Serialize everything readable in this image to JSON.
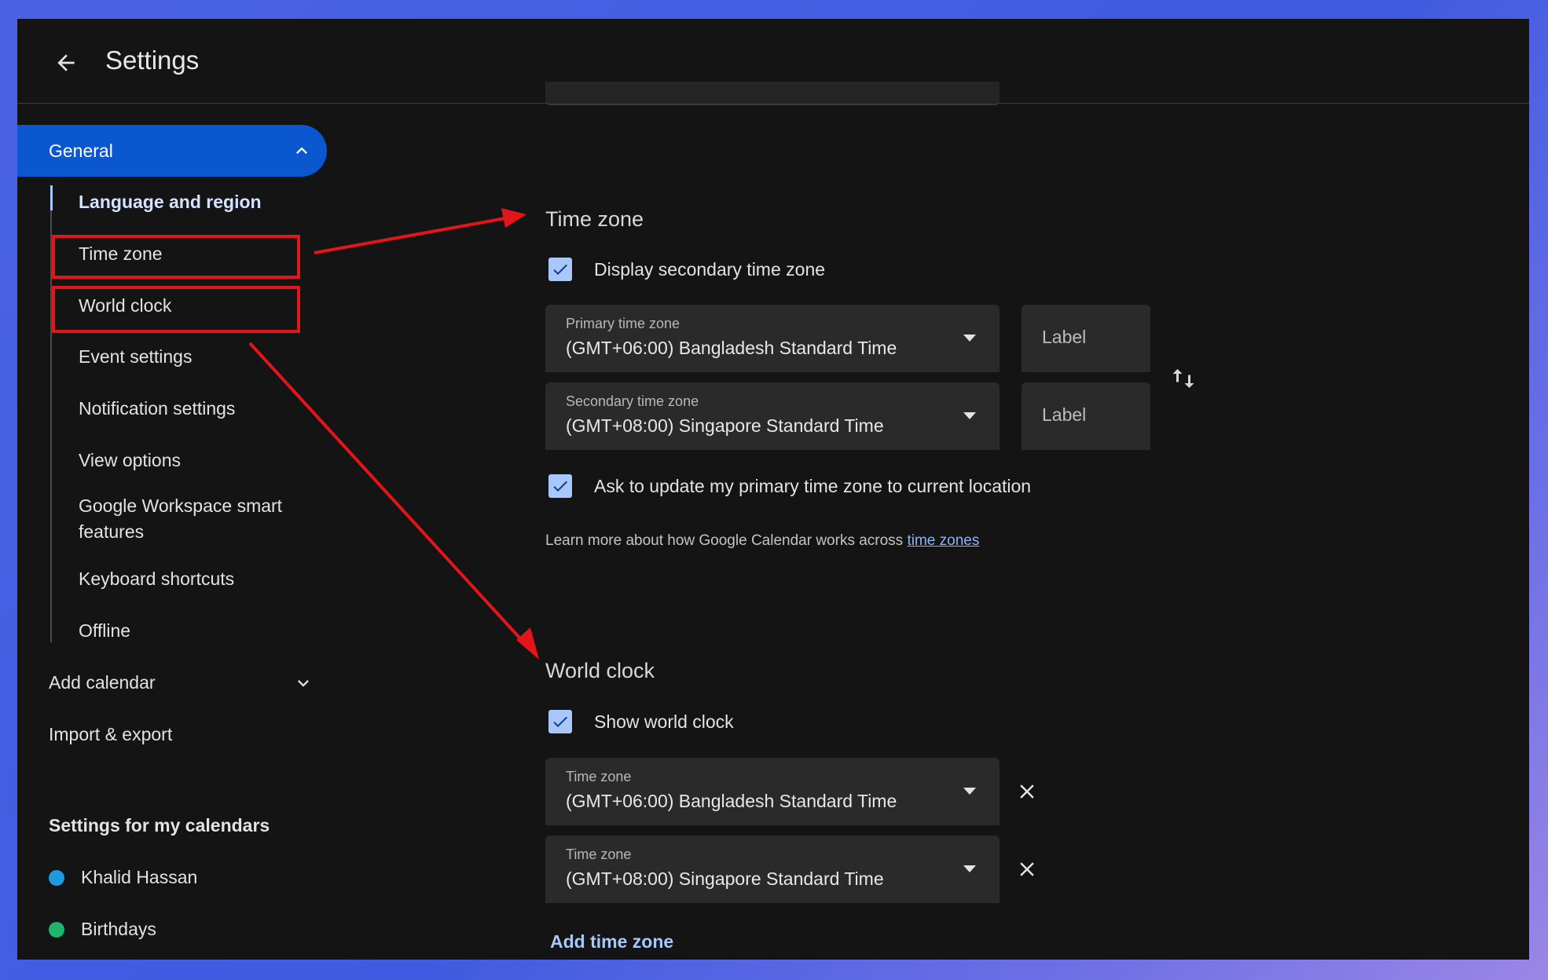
{
  "header": {
    "title": "Settings"
  },
  "sidebar": {
    "general_label": "General",
    "sub_items": [
      {
        "label": "Language and region"
      },
      {
        "label": "Time zone"
      },
      {
        "label": "World clock"
      },
      {
        "label": "Event settings"
      },
      {
        "label": "Notification settings"
      },
      {
        "label": "View options"
      },
      {
        "label": "Google Workspace smart features"
      },
      {
        "label": "Keyboard shortcuts"
      },
      {
        "label": "Offline"
      }
    ],
    "add_calendar": "Add calendar",
    "import_export": "Import & export",
    "my_calendars_heading": "Settings for my calendars",
    "calendars": [
      {
        "name": "Khalid Hassan",
        "color": "#1e9be0"
      },
      {
        "name": "Birthdays",
        "color": "#1fb56b"
      }
    ]
  },
  "time_zone": {
    "heading": "Time zone",
    "display_secondary": {
      "label": "Display secondary time zone",
      "checked": true
    },
    "primary": {
      "caption": "Primary time zone",
      "value": "(GMT+06:00) Bangladesh Standard Time",
      "label_placeholder": "Label"
    },
    "secondary": {
      "caption": "Secondary time zone",
      "value": "(GMT+08:00) Singapore Standard Time",
      "label_placeholder": "Label"
    },
    "ask_update": {
      "label": "Ask to update my primary time zone to current location",
      "checked": true
    },
    "learn_more_text": "Learn more about how Google Calendar works across ",
    "learn_more_link": "time zones"
  },
  "world_clock": {
    "heading": "World clock",
    "show": {
      "label": "Show world clock",
      "checked": true
    },
    "zones": [
      {
        "caption": "Time zone",
        "value": "(GMT+06:00) Bangladesh Standard Time"
      },
      {
        "caption": "Time zone",
        "value": "(GMT+08:00) Singapore Standard Time"
      }
    ],
    "add_label": "Add time zone"
  },
  "colors": {
    "accent": "#0b57d0",
    "checkbox": "#a8c7fa",
    "annotation": "#e4141b",
    "background": "#141414"
  }
}
